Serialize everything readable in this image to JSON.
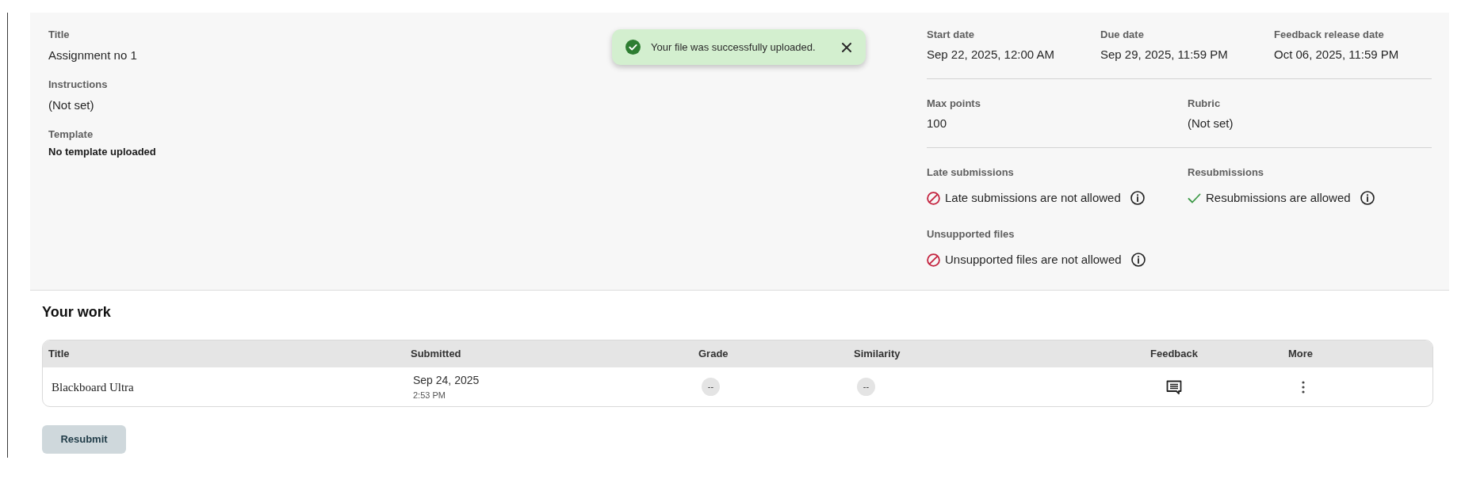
{
  "details": [
    {
      "label": "Title",
      "value": "Assignment no 1",
      "kind": "plain"
    },
    {
      "label": "Instructions",
      "value": "(Not set)",
      "kind": "plain"
    },
    {
      "label": "Template",
      "value": "No template uploaded",
      "kind": "strong"
    }
  ],
  "toast": {
    "message": "Your file was successfully uploaded."
  },
  "dates": [
    {
      "label": "Start date",
      "value": "Sep 22, 2025, 12:00 AM"
    },
    {
      "label": "Due date",
      "value": "Sep 29, 2025, 11:59 PM"
    },
    {
      "label": "Feedback release date",
      "value": "Oct 06, 2025, 11:59 PM"
    }
  ],
  "grading": [
    {
      "label": "Max points",
      "value": "100"
    },
    {
      "label": "Rubric",
      "value": "(Not set)"
    }
  ],
  "policies": [
    {
      "label": "Late submissions",
      "text": "Late submissions are not allowed",
      "allowed": false
    },
    {
      "label": "Resubmissions",
      "text": "Resubmissions are allowed",
      "allowed": true
    },
    {
      "label": "Unsupported files",
      "text": "Unsupported files are not allowed",
      "allowed": false
    }
  ],
  "your_work": {
    "heading": "Your work",
    "columns": [
      "Title",
      "Submitted",
      "Grade",
      "Similarity",
      "Feedback",
      "More"
    ],
    "rows": [
      {
        "title": "Blackboard Ultra",
        "submitted_date": "Sep 24, 2025",
        "submitted_time": "2:53 PM",
        "grade": "--",
        "similarity": "--"
      }
    ]
  },
  "resubmit_button": "Resubmit"
}
